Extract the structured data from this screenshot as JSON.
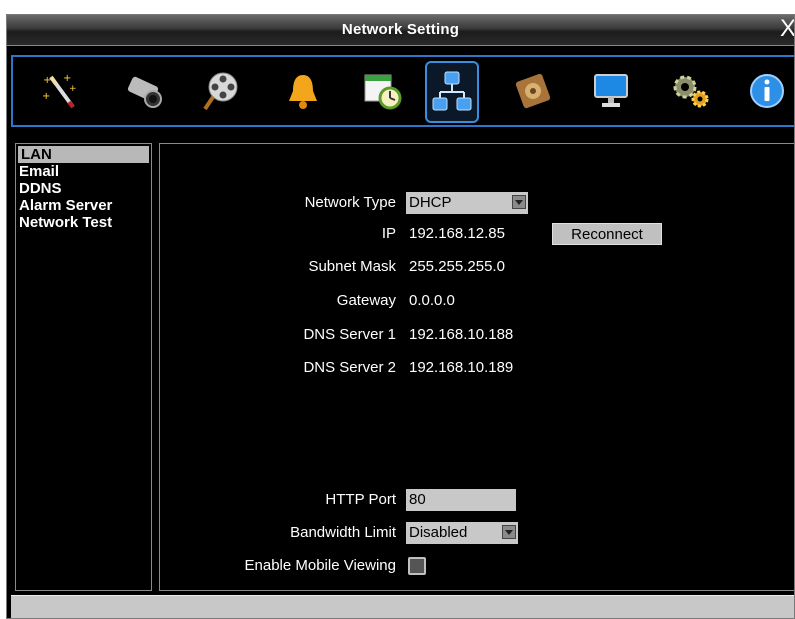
{
  "window": {
    "title": "Network Setting",
    "close_glyph": "X"
  },
  "toolbar": {
    "icons": [
      "wizard-wand-icon",
      "camera-icon",
      "film-reel-icon",
      "bell-alarm-icon",
      "schedule-clock-icon",
      "network-icon",
      "hard-disk-icon",
      "monitor-icon",
      "gears-icon",
      "info-icon"
    ],
    "selected": "network-icon"
  },
  "sidebar": {
    "items": [
      {
        "label": "LAN",
        "active": true
      },
      {
        "label": "Email"
      },
      {
        "label": "DDNS"
      },
      {
        "label": "Alarm Server"
      },
      {
        "label": "Network Test"
      }
    ]
  },
  "form": {
    "network_type": {
      "label": "Network Type",
      "value": "DHCP"
    },
    "ip": {
      "label": "IP",
      "value": "192.168.12.85"
    },
    "reconnect_label": "Reconnect",
    "subnet_mask": {
      "label": "Subnet Mask",
      "value": "255.255.255.0"
    },
    "gateway": {
      "label": "Gateway",
      "value": "0.0.0.0"
    },
    "dns1": {
      "label": "DNS Server 1",
      "value": "192.168.10.188"
    },
    "dns2": {
      "label": "DNS Server 2",
      "value": "192.168.10.189"
    },
    "http_port": {
      "label": "HTTP Port",
      "value": "80"
    },
    "bandwidth_limit": {
      "label": "Bandwidth Limit",
      "value": "Disabled"
    },
    "mobile_viewing": {
      "label": "Enable Mobile Viewing",
      "checked": false
    }
  },
  "colors": {
    "accent": "#2b78c8",
    "control_bg": "#c8c8c8",
    "window_bg": "#000000"
  }
}
